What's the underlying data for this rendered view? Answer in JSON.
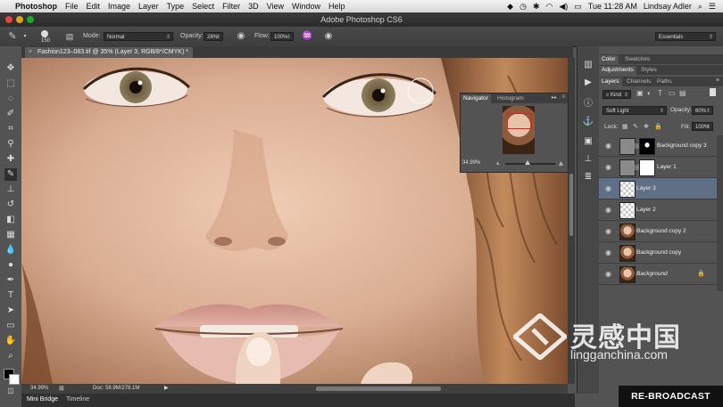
{
  "menubar": {
    "app_name": "Photoshop",
    "items": [
      "File",
      "Edit",
      "Image",
      "Layer",
      "Type",
      "Select",
      "Filter",
      "3D",
      "View",
      "Window",
      "Help"
    ],
    "clock": "Tue 11:28 AM",
    "user": "Lindsay Adler"
  },
  "window": {
    "title": "Adobe Photoshop CS6"
  },
  "options_bar": {
    "brush_size": "150",
    "mode_label": "Mode:",
    "mode_value": "Normal",
    "opacity_label": "Opacity:",
    "opacity_value": "28%",
    "flow_label": "Flow:",
    "flow_value": "100%",
    "workspace_value": "Essentials"
  },
  "document_tab": {
    "title": "Fashion123–083.tif @ 35% (Layer 3, RGB/8*/CMYK) *"
  },
  "status_bar": {
    "zoom": "34.99%",
    "doc_size": "Doc: 58.9M/278.1M"
  },
  "bottom_tabs": [
    "Mini Bridge",
    "Timeline"
  ],
  "navigator": {
    "tabs": [
      "Navigator",
      "Histogram"
    ],
    "zoom": "34.99%"
  },
  "color_panel": {
    "tabs": [
      "Color",
      "Swatches"
    ]
  },
  "adjustments_panel": {
    "tabs": [
      "Adjustments",
      "Styles"
    ]
  },
  "layers_panel": {
    "tabs": [
      "Layers",
      "Channels",
      "Paths"
    ],
    "filter_kind": "Kind",
    "blend_mode": "Soft Light",
    "opacity_label": "Opacity:",
    "opacity_value": "60%",
    "lock_label": "Lock:",
    "fill_label": "Fill:",
    "fill_value": "100%",
    "layers": [
      {
        "name": "Background copy 3",
        "thumb": "gray",
        "mask": true,
        "selected": false
      },
      {
        "name": "Layer 1",
        "thumb": "gray",
        "mask": true,
        "selected": false
      },
      {
        "name": "Layer 3",
        "thumb": "checker",
        "mask": false,
        "selected": true
      },
      {
        "name": "Layer 2",
        "thumb": "checker",
        "mask": false,
        "selected": false
      },
      {
        "name": "Background copy 2",
        "thumb": "face",
        "mask": false,
        "selected": false
      },
      {
        "name": "Background copy",
        "thumb": "face",
        "mask": false,
        "selected": false
      },
      {
        "name": "Background",
        "thumb": "face",
        "mask": false,
        "selected": false,
        "locked": true
      }
    ]
  },
  "watermark": {
    "brand": "灵感中国",
    "url": "lingganchina.com"
  },
  "overlay": {
    "rebroadcast": "RE-BROADCAST"
  }
}
